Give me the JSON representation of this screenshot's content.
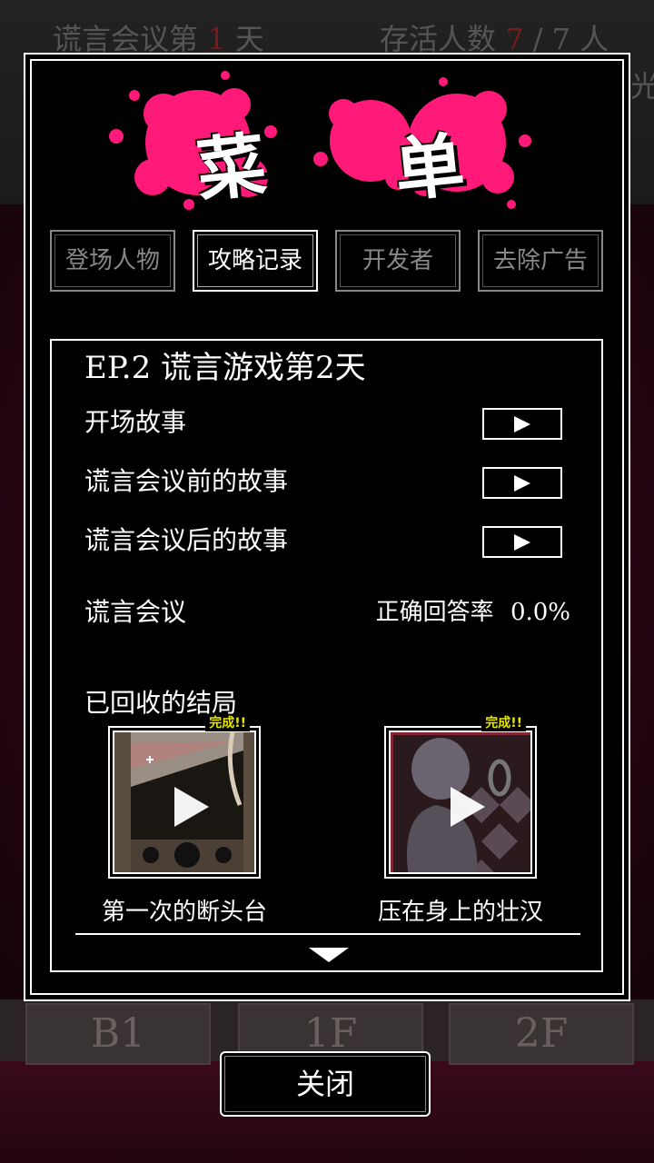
{
  "background": {
    "meeting_prefix": "谎言会议第",
    "meeting_day": "1",
    "meeting_suffix": "天",
    "alive_label": "存活人数",
    "alive_count": "7",
    "alive_total": "/ 7 人",
    "side_text": "光",
    "floors": [
      "B1",
      "1F",
      "2F"
    ]
  },
  "menu": {
    "title_chars": [
      "菜",
      "单"
    ],
    "splash_color": "#ff1a7a",
    "tabs": [
      {
        "label": "登场人物",
        "active": false
      },
      {
        "label": "攻略记录",
        "active": true
      },
      {
        "label": "开发者",
        "active": false
      },
      {
        "label": "去除广告",
        "active": false
      }
    ],
    "episode_title": "EP.2  谎言游戏第2天",
    "stories": [
      {
        "label": "开场故事"
      },
      {
        "label": "谎言会议前的故事"
      },
      {
        "label": "谎言会议后的故事"
      }
    ],
    "meeting_label": "谎言会议",
    "accuracy_label": "正确回答率",
    "accuracy_value": "0.0%",
    "endings_label": "已回收的结局",
    "endings": [
      {
        "caption": "第一次的断头台",
        "badge": "完成!!"
      },
      {
        "caption": "压在身上的壮汉",
        "badge": "完成!!"
      }
    ],
    "close_label": "关闭"
  }
}
